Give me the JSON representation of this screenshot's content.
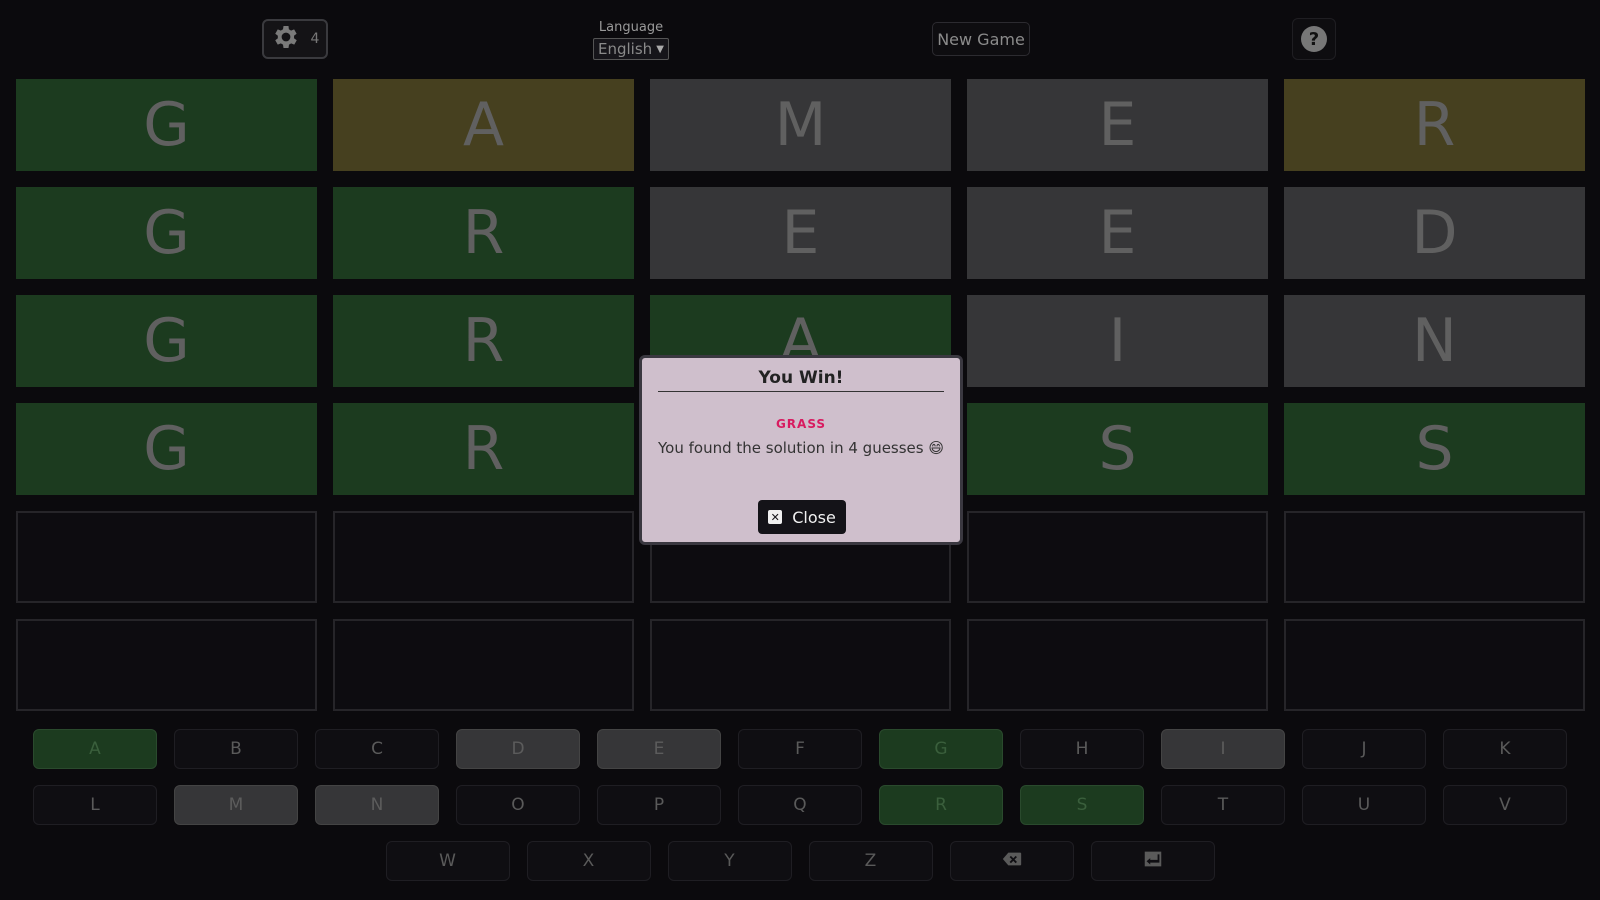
{
  "header": {
    "settings_count": "4",
    "language_label": "Language",
    "language_selected": "English",
    "new_game_label": "New Game",
    "help_label": "?"
  },
  "board": {
    "rows": [
      [
        {
          "letter": "G",
          "state": "correct"
        },
        {
          "letter": "A",
          "state": "present"
        },
        {
          "letter": "M",
          "state": "absent"
        },
        {
          "letter": "E",
          "state": "absent"
        },
        {
          "letter": "R",
          "state": "present"
        }
      ],
      [
        {
          "letter": "G",
          "state": "correct"
        },
        {
          "letter": "R",
          "state": "correct"
        },
        {
          "letter": "E",
          "state": "absent"
        },
        {
          "letter": "E",
          "state": "absent"
        },
        {
          "letter": "D",
          "state": "absent"
        }
      ],
      [
        {
          "letter": "G",
          "state": "correct"
        },
        {
          "letter": "R",
          "state": "correct"
        },
        {
          "letter": "A",
          "state": "correct"
        },
        {
          "letter": "I",
          "state": "absent"
        },
        {
          "letter": "N",
          "state": "absent"
        }
      ],
      [
        {
          "letter": "G",
          "state": "correct"
        },
        {
          "letter": "R",
          "state": "correct"
        },
        {
          "letter": "",
          "state": "correct"
        },
        {
          "letter": "S",
          "state": "correct"
        },
        {
          "letter": "S",
          "state": "correct"
        }
      ],
      [
        {
          "letter": "",
          "state": "empty"
        },
        {
          "letter": "",
          "state": "empty"
        },
        {
          "letter": "",
          "state": "empty"
        },
        {
          "letter": "",
          "state": "empty"
        },
        {
          "letter": "",
          "state": "empty"
        }
      ],
      [
        {
          "letter": "",
          "state": "empty"
        },
        {
          "letter": "",
          "state": "empty"
        },
        {
          "letter": "",
          "state": "empty"
        },
        {
          "letter": "",
          "state": "empty"
        },
        {
          "letter": "",
          "state": "empty"
        }
      ]
    ]
  },
  "keyboard": {
    "rows": [
      [
        {
          "label": "A",
          "state": "correct"
        },
        {
          "label": "B",
          "state": "unused"
        },
        {
          "label": "C",
          "state": "unused"
        },
        {
          "label": "D",
          "state": "absent"
        },
        {
          "label": "E",
          "state": "absent"
        },
        {
          "label": "F",
          "state": "unused"
        },
        {
          "label": "G",
          "state": "correct"
        },
        {
          "label": "H",
          "state": "unused"
        },
        {
          "label": "I",
          "state": "absent"
        },
        {
          "label": "J",
          "state": "unused"
        },
        {
          "label": "K",
          "state": "unused"
        }
      ],
      [
        {
          "label": "L",
          "state": "unused"
        },
        {
          "label": "M",
          "state": "absent"
        },
        {
          "label": "N",
          "state": "absent"
        },
        {
          "label": "O",
          "state": "unused"
        },
        {
          "label": "P",
          "state": "unused"
        },
        {
          "label": "Q",
          "state": "unused"
        },
        {
          "label": "R",
          "state": "correct"
        },
        {
          "label": "S",
          "state": "correct"
        },
        {
          "label": "T",
          "state": "unused"
        },
        {
          "label": "U",
          "state": "unused"
        },
        {
          "label": "V",
          "state": "unused"
        }
      ],
      [
        {
          "label": "W",
          "state": "unused"
        },
        {
          "label": "X",
          "state": "unused"
        },
        {
          "label": "Y",
          "state": "unused"
        },
        {
          "label": "Z",
          "state": "unused"
        },
        {
          "label": "",
          "icon": "backspace-icon",
          "state": "unused"
        },
        {
          "label": "",
          "icon": "enter-icon",
          "state": "unused"
        }
      ]
    ]
  },
  "modal": {
    "title": "You Win!",
    "solution": "GRASS",
    "message": "You found the solution in 4 guesses 😄",
    "close_label": "Close"
  },
  "colors": {
    "correct": "#1c3b1f",
    "present": "#46401f",
    "absent": "#363638",
    "modal_bg": "#cfbfcc",
    "solution_accent": "#d81b60"
  }
}
